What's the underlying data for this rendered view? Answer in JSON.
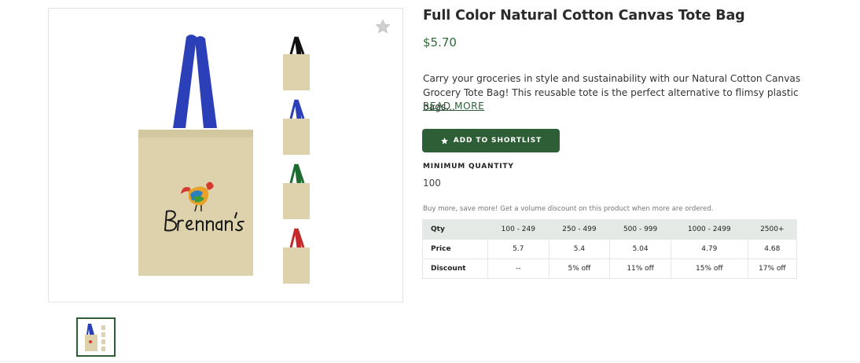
{
  "product": {
    "title": "Full Color Natural Cotton Canvas Tote Bag",
    "price": "$5.70",
    "description": "Carry your groceries in style and sustainability with our Natural Cotton Canvas Grocery Tote Bag! This reusable tote is the perfect alternative to flimsy plastic bags...",
    "read_more": "READ MORE",
    "shortlist_label": "ADD TO SHORTLIST",
    "min_qty_label": "MINIMUM QUANTITY",
    "min_qty_value": "100",
    "volume_note": "Buy more, save more! Get a volume discount on this product when more are ordered.",
    "logo_text": "Brennan's"
  },
  "pricing": {
    "header": [
      "Qty",
      "100 - 249",
      "250 - 499",
      "500 - 999",
      "1000 - 2499",
      "2500+"
    ],
    "rows": [
      [
        "Price",
        "5.7",
        "5.4",
        "5.04",
        "4.79",
        "4.68"
      ],
      [
        "Discount",
        "--",
        "5% off",
        "11% off",
        "15% off",
        "17% off"
      ]
    ]
  },
  "icons": {
    "favorite": "star-icon",
    "shortlist": "star-icon"
  },
  "colors": {
    "brand_green": "#2e5e36",
    "price_green": "#2e6b3a",
    "handle_blue": "#2a3fb8",
    "variant_handles": [
      "#111111",
      "#2a3fb8",
      "#1e6b32",
      "#c42a2a"
    ]
  }
}
